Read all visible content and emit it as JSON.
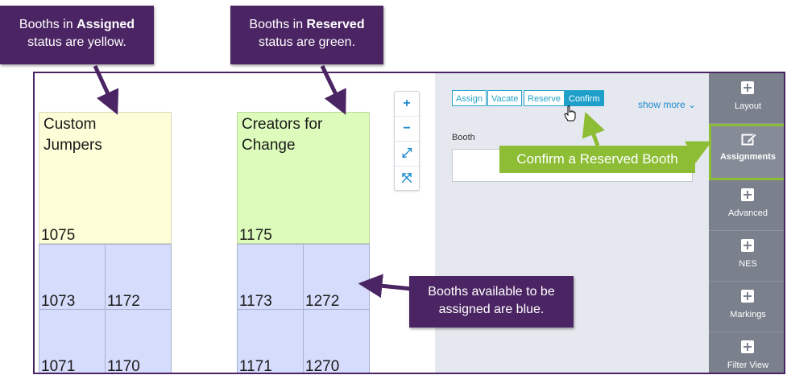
{
  "callouts": {
    "assigned": {
      "prefix": "Booths in ",
      "emphasis": "Assigned",
      "suffix": "status are yellow."
    },
    "reserved": {
      "prefix": "Booths in ",
      "emphasis": "Reserved",
      "suffix": "status are green."
    },
    "available": {
      "line1": "Booths available to be",
      "line2": "assigned are blue."
    },
    "confirm": "Confirm a Reserved Booth"
  },
  "floor_map": {
    "booths": [
      {
        "name_line1": "Custom",
        "name_line2": "Jumpers",
        "number": "1075",
        "status": "Assigned",
        "color": "#fdfed8"
      },
      {
        "name_line1": "Creators for",
        "name_line2": "Change",
        "number": "1175",
        "status": "Reserved",
        "color": "#ddfcbb"
      },
      {
        "number": "1073",
        "status": "Available",
        "color": "#d5dcfc"
      },
      {
        "number": "1172",
        "status": "Available",
        "color": "#d5dcfc"
      },
      {
        "number": "1173",
        "status": "Available",
        "color": "#d5dcfc"
      },
      {
        "number": "1272",
        "status": "Available",
        "color": "#d5dcfc"
      },
      {
        "number": "1071",
        "status": "Available",
        "color": "#d5dcfc"
      },
      {
        "number": "1170",
        "status": "Available",
        "color": "#d5dcfc"
      },
      {
        "number": "1171",
        "status": "Available",
        "color": "#d5dcfc"
      },
      {
        "number": "1270",
        "status": "Available",
        "color": "#d5dcfc"
      }
    ],
    "zoom_controls": [
      {
        "icon": "zoom-in-icon",
        "glyph": "+"
      },
      {
        "icon": "zoom-out-icon",
        "glyph": "−"
      },
      {
        "icon": "expand-icon",
        "glyph": "⤢"
      },
      {
        "icon": "fit-to-screen-icon",
        "glyph": "⤧"
      }
    ]
  },
  "toolbar": {
    "assign": "Assign",
    "vacate": "Vacate",
    "reserve": "Reserve",
    "confirm": "Confirm",
    "show_more": "show more ⌄"
  },
  "form": {
    "booth_label": "Booth",
    "booth_value": ""
  },
  "sidebar": {
    "items": [
      {
        "label": "Layout",
        "icon": "plus-square-icon"
      },
      {
        "label": "Assignments",
        "icon": "edit-icon",
        "active": true
      },
      {
        "label": "Advanced",
        "icon": "plus-square-icon"
      },
      {
        "label": "NES",
        "icon": "plus-square-icon"
      },
      {
        "label": "Markings",
        "icon": "plus-square-icon"
      },
      {
        "label": "Filter View",
        "icon": "plus-square-icon"
      }
    ]
  },
  "colors": {
    "callout": "#4b2563",
    "highlight": "#8dbd34",
    "accent": "#1d9fc9",
    "sidebar": "#7a808c"
  }
}
